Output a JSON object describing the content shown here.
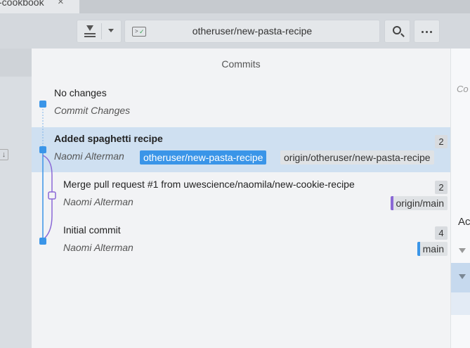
{
  "tab": {
    "label": "-cookbook",
    "close": "×"
  },
  "toolbar": {
    "current_branch": "otheruser/new-pasta-recipe"
  },
  "panel": {
    "title": "Commits"
  },
  "commits": [
    {
      "title": "No changes",
      "author": "Commit Changes"
    },
    {
      "title": "Added spaghetti recipe",
      "author": "Naomi Alterman",
      "count": "2",
      "refs": [
        "otheruser/new-pasta-recipe",
        "origin/otheruser/new-pasta-recipe"
      ]
    },
    {
      "title": "Merge pull request #1 from uwescience/naomila/new-cookie-recipe",
      "author": "Naomi Alterman",
      "count": "2",
      "refs": [
        "origin/main"
      ]
    },
    {
      "title": "Initial commit",
      "author": "Naomi Alterman",
      "count": "4",
      "refs": [
        "main"
      ]
    }
  ],
  "right_panel": {
    "text1": "Co",
    "text2": "Ac"
  },
  "sidebar": {
    "arrow": "↓"
  },
  "colors": {
    "accent": "#3a95e8",
    "graph_blue": "#3a95e8",
    "graph_purple": "#8a68d6",
    "selected_row": "#cfe0f1"
  },
  "icons": [
    "pull-icon",
    "dropdown-caret-icon",
    "terminal-icon",
    "search-icon",
    "more-icon",
    "close-icon"
  ]
}
